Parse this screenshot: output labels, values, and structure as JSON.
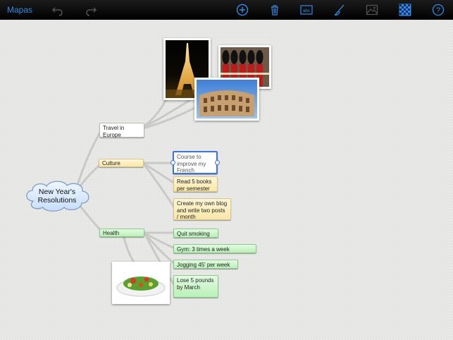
{
  "toolbar": {
    "back_label": "Mapas",
    "icons": [
      "undo-icon",
      "redo-icon",
      "add-icon",
      "trash-icon",
      "text-style-icon",
      "brush-icon",
      "image-icon",
      "background-pattern-icon",
      "help-icon"
    ],
    "text_icon_label": "abc",
    "help_glyph": "?",
    "accent_color": "#2f8be6"
  },
  "map": {
    "central": "New Year's Resolutions",
    "branches": {
      "travel": "Travel in Europe",
      "culture": "Culture",
      "health": "Health"
    },
    "culture_items": [
      "Course to improve my French",
      "Read 5 books per semester",
      "Create my own blog and write two posts / month"
    ],
    "health_items": [
      "Quit smoking",
      "Gym: 3 times a week",
      "Jogging 45' per week",
      "Lose 5 pounds by March"
    ],
    "images": [
      "eiffel-tower-photo",
      "royal-guards-photo",
      "colosseum-photo",
      "salad-photo"
    ],
    "colors": {
      "culture": "#f9e6a8",
      "health": "#b9f0b7",
      "selection": "#3b74e6"
    }
  }
}
